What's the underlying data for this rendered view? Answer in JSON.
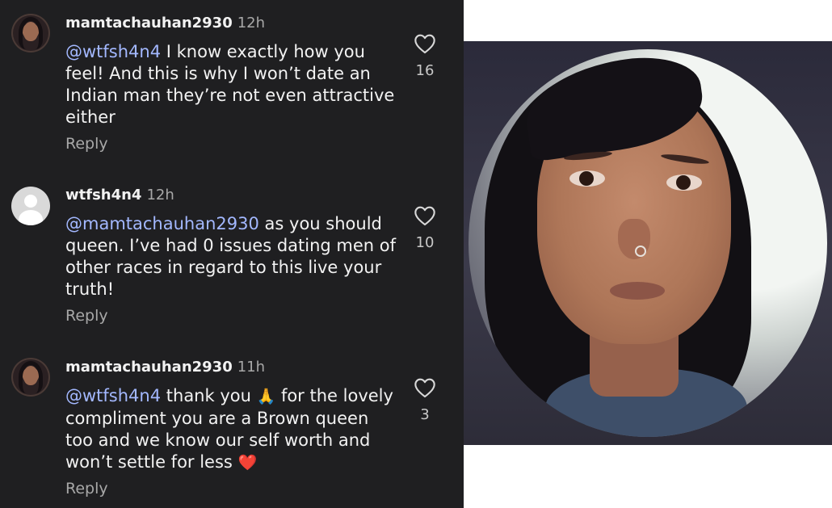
{
  "comments": [
    {
      "username": "mamtachauhan2930",
      "time": "12h",
      "mention": "@wtfsh4n4",
      "text": " I know exactly how you feel! And this is why I won’t date an Indian man they’re not even attractive either",
      "reply_label": "Reply",
      "likes": "16",
      "avatar": "profile-photo"
    },
    {
      "username": "wtfsh4n4",
      "time": "12h",
      "mention": "@mamtachauhan2930",
      "text": " as you should queen. I’ve had 0 issues dating men of other races in regard to this live your truth!",
      "reply_label": "Reply",
      "likes": "10",
      "avatar": "default-user-icon"
    },
    {
      "username": "mamtachauhan2930",
      "time": "11h",
      "mention": "@wtfsh4n4",
      "text_before_emoji": " thank you ",
      "emoji_pray": "🙏",
      "text_after_emoji": " for the lovely compliment you are a Brown queen too and we know our self worth and won’t settle for less ",
      "emoji_heart": "❤️",
      "reply_label": "Reply",
      "likes": "3",
      "avatar": "profile-photo"
    }
  ],
  "colors": {
    "panel_background": "#1f1f21",
    "text": "#f2f2f2",
    "mention": "#a3b8ff",
    "secondary_text": "#a8a8a8"
  },
  "icons": {
    "like": "heart-outline-icon",
    "default_avatar": "default-user-icon"
  }
}
